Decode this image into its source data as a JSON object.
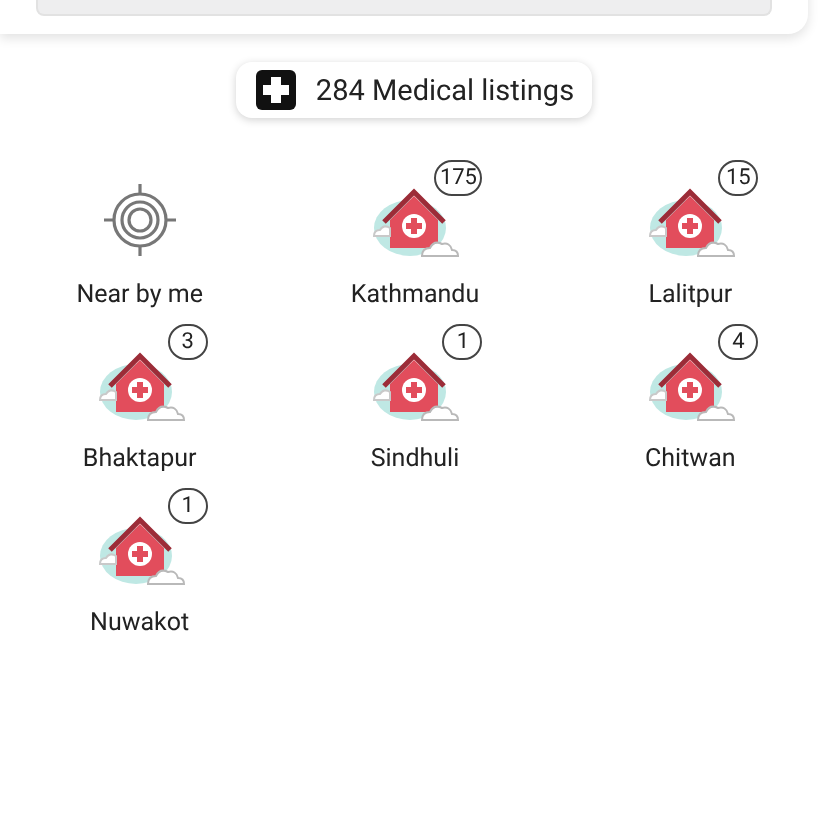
{
  "summary": {
    "label": "284 Medical listings"
  },
  "locations": [
    {
      "kind": "nearby",
      "label": "Near by me"
    },
    {
      "kind": "city",
      "label": "Kathmandu",
      "count": "175"
    },
    {
      "kind": "city",
      "label": "Lalitpur",
      "count": "15"
    },
    {
      "kind": "city",
      "label": "Bhaktapur",
      "count": "3"
    },
    {
      "kind": "city",
      "label": "Sindhuli",
      "count": "1"
    },
    {
      "kind": "city",
      "label": "Chitwan",
      "count": "4"
    },
    {
      "kind": "city",
      "label": "Nuwakot",
      "count": "1"
    }
  ]
}
